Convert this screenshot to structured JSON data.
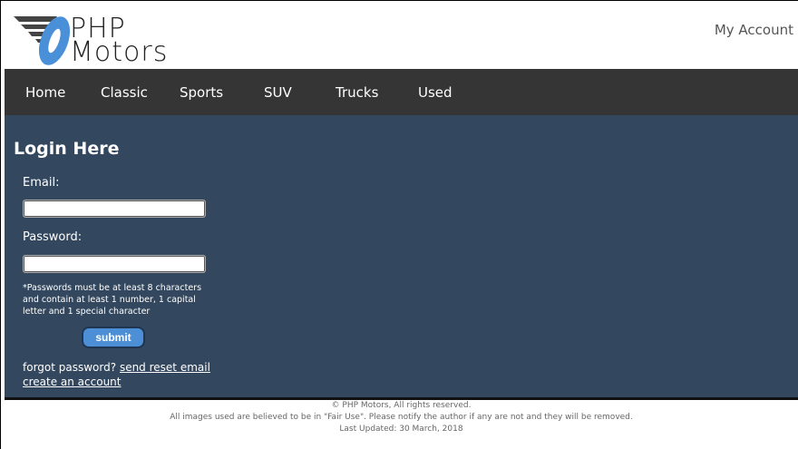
{
  "header": {
    "logo_line1": "PHP",
    "logo_line2": "Motors",
    "my_account": "My Account"
  },
  "nav": {
    "items": [
      "Home",
      "Classic",
      "Sports",
      "SUV",
      "Trucks",
      "Used"
    ]
  },
  "login": {
    "title": "Login Here",
    "email_label": "Email:",
    "email_value": "",
    "password_label": "Password:",
    "password_value": "",
    "password_note": "*Passwords must be at least 8 characters and contain at least 1 number, 1 capital letter and 1 special character",
    "submit_label": "submit",
    "forgot_text": "forgot password?",
    "reset_link": "send reset email",
    "create_link": "create an account"
  },
  "footer": {
    "copyright": "© PHP Motors, All rights reserved.",
    "images_notice": "All images used are believed to be in \"Fair Use\". Please notify the author if any are not and they will be removed.",
    "last_updated": "Last Updated: 30 March, 2018"
  },
  "colors": {
    "nav_bg": "#353535",
    "main_bg": "#33475e",
    "button_bg": "#4d8fd6",
    "logo_accent": "#4a90d9"
  }
}
